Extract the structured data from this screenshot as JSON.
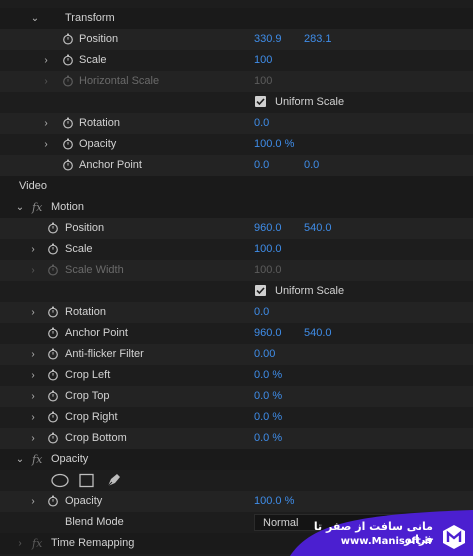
{
  "sections": {
    "transform": "Transform",
    "video": "Video",
    "motion": "Motion",
    "opacity": "Opacity",
    "time_remapping": "Time Remapping"
  },
  "transform": {
    "position": {
      "label": "Position",
      "x": "330.9",
      "y": "283.1"
    },
    "scale": {
      "label": "Scale",
      "value": "100"
    },
    "horizontal_scale": {
      "label": "Horizontal Scale",
      "value": "100"
    },
    "uniform_scale": {
      "label": "Uniform Scale",
      "checked": true
    },
    "rotation": {
      "label": "Rotation",
      "value": "0.0"
    },
    "opacity": {
      "label": "Opacity",
      "value": "100.0 %"
    },
    "anchor_point": {
      "label": "Anchor Point",
      "x": "0.0",
      "y": "0.0"
    }
  },
  "motion": {
    "position": {
      "label": "Position",
      "x": "960.0",
      "y": "540.0"
    },
    "scale": {
      "label": "Scale",
      "value": "100.0"
    },
    "scale_width": {
      "label": "Scale Width",
      "value": "100.0"
    },
    "uniform_scale": {
      "label": "Uniform Scale",
      "checked": true
    },
    "rotation": {
      "label": "Rotation",
      "value": "0.0"
    },
    "anchor_point": {
      "label": "Anchor Point",
      "x": "960.0",
      "y": "540.0"
    },
    "anti_flicker": {
      "label": "Anti-flicker Filter",
      "value": "0.00"
    },
    "crop_left": {
      "label": "Crop Left",
      "value": "0.0 %"
    },
    "crop_top": {
      "label": "Crop Top",
      "value": "0.0 %"
    },
    "crop_right": {
      "label": "Crop Right",
      "value": "0.0 %"
    },
    "crop_bottom": {
      "label": "Crop Bottom",
      "value": "0.0 %"
    }
  },
  "opacity_section": {
    "opacity": {
      "label": "Opacity",
      "value": "100.0 %"
    },
    "blend_mode": {
      "label": "Blend Mode",
      "value": "Normal"
    }
  },
  "watermark": {
    "title": "مانی سافت از صفر تا فراتر",
    "url": "www.Manisoft.ir"
  },
  "colors": {
    "value_blue": "#3f8de9",
    "background": "#1d1d1d",
    "watermark_purple": "#4b1fd0"
  },
  "icons": {
    "expand": "chevron-right-icon",
    "collapse": "chevron-down-icon",
    "keyframe": "stopwatch-icon",
    "effect": "fx-icon",
    "mask_ellipse": "ellipse-mask-icon",
    "mask_rect": "rectangle-mask-icon",
    "mask_pen": "pen-mask-icon"
  }
}
